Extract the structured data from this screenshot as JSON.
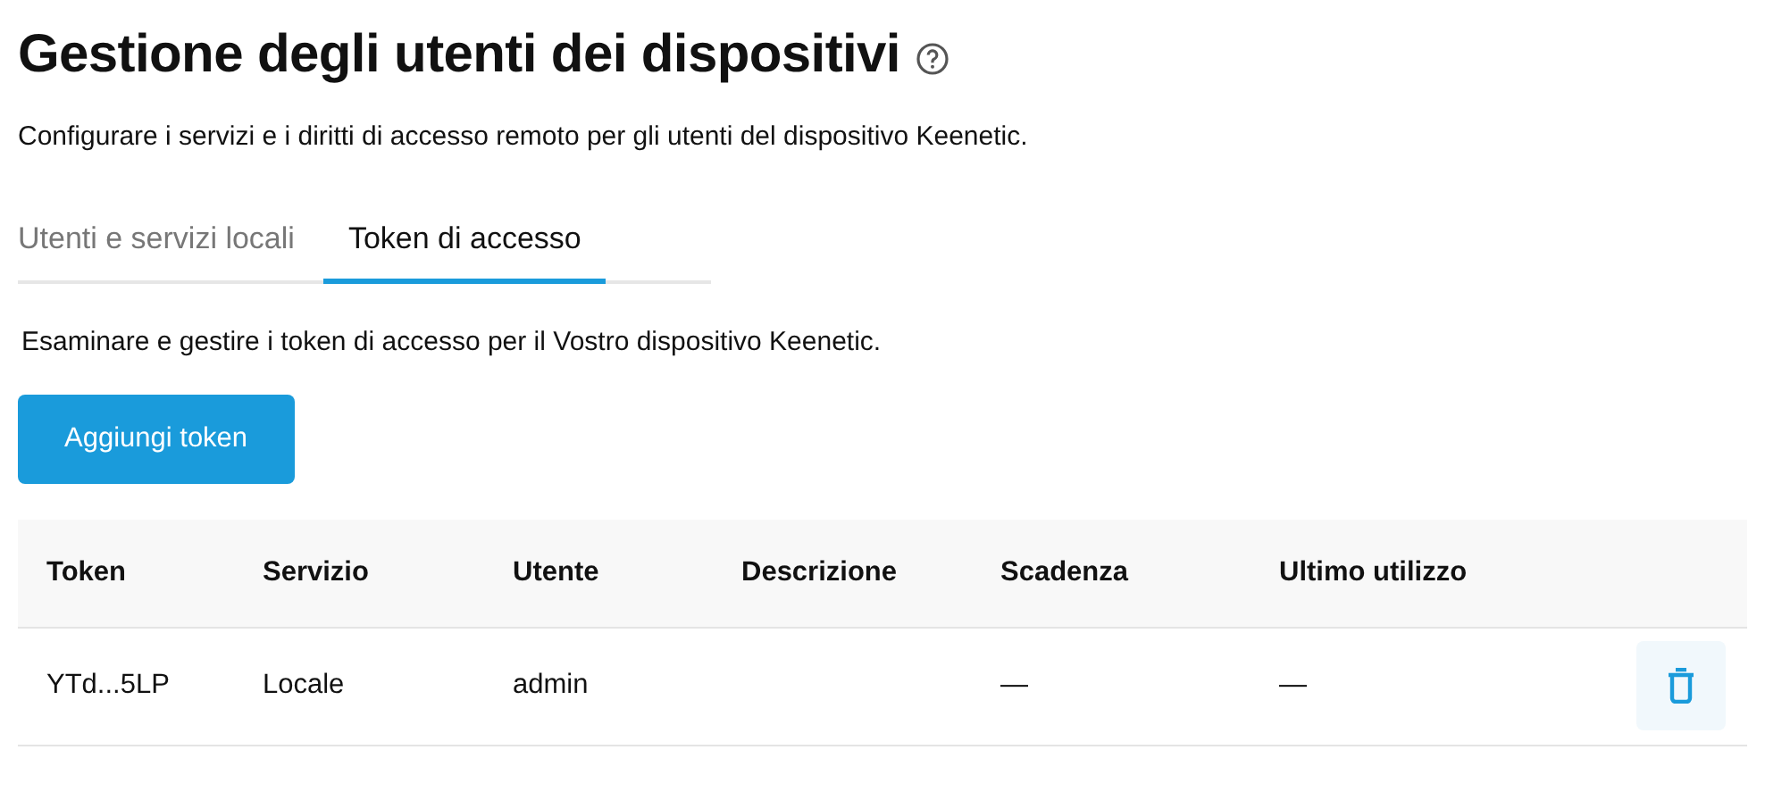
{
  "title": "Gestione degli utenti dei dispositivi",
  "subtitle": "Configurare i servizi e i diritti di accesso remoto per gli utenti del dispositivo Keenetic.",
  "tabs": [
    {
      "label": "Utenti e servizi locali",
      "selected": false
    },
    {
      "label": "Token di accesso",
      "selected": true
    }
  ],
  "tab_description": "Esaminare e gestire i token di accesso per il Vostro dispositivo Keenetic.",
  "add_button": "Aggiungi token",
  "table": {
    "columns": [
      "Token",
      "Servizio",
      "Utente",
      "Descrizione",
      "Scadenza",
      "Ultimo utilizzo"
    ],
    "rows": [
      {
        "cells": [
          "YTd...5LP",
          "Locale",
          "admin",
          "",
          "—",
          "—"
        ]
      }
    ]
  }
}
